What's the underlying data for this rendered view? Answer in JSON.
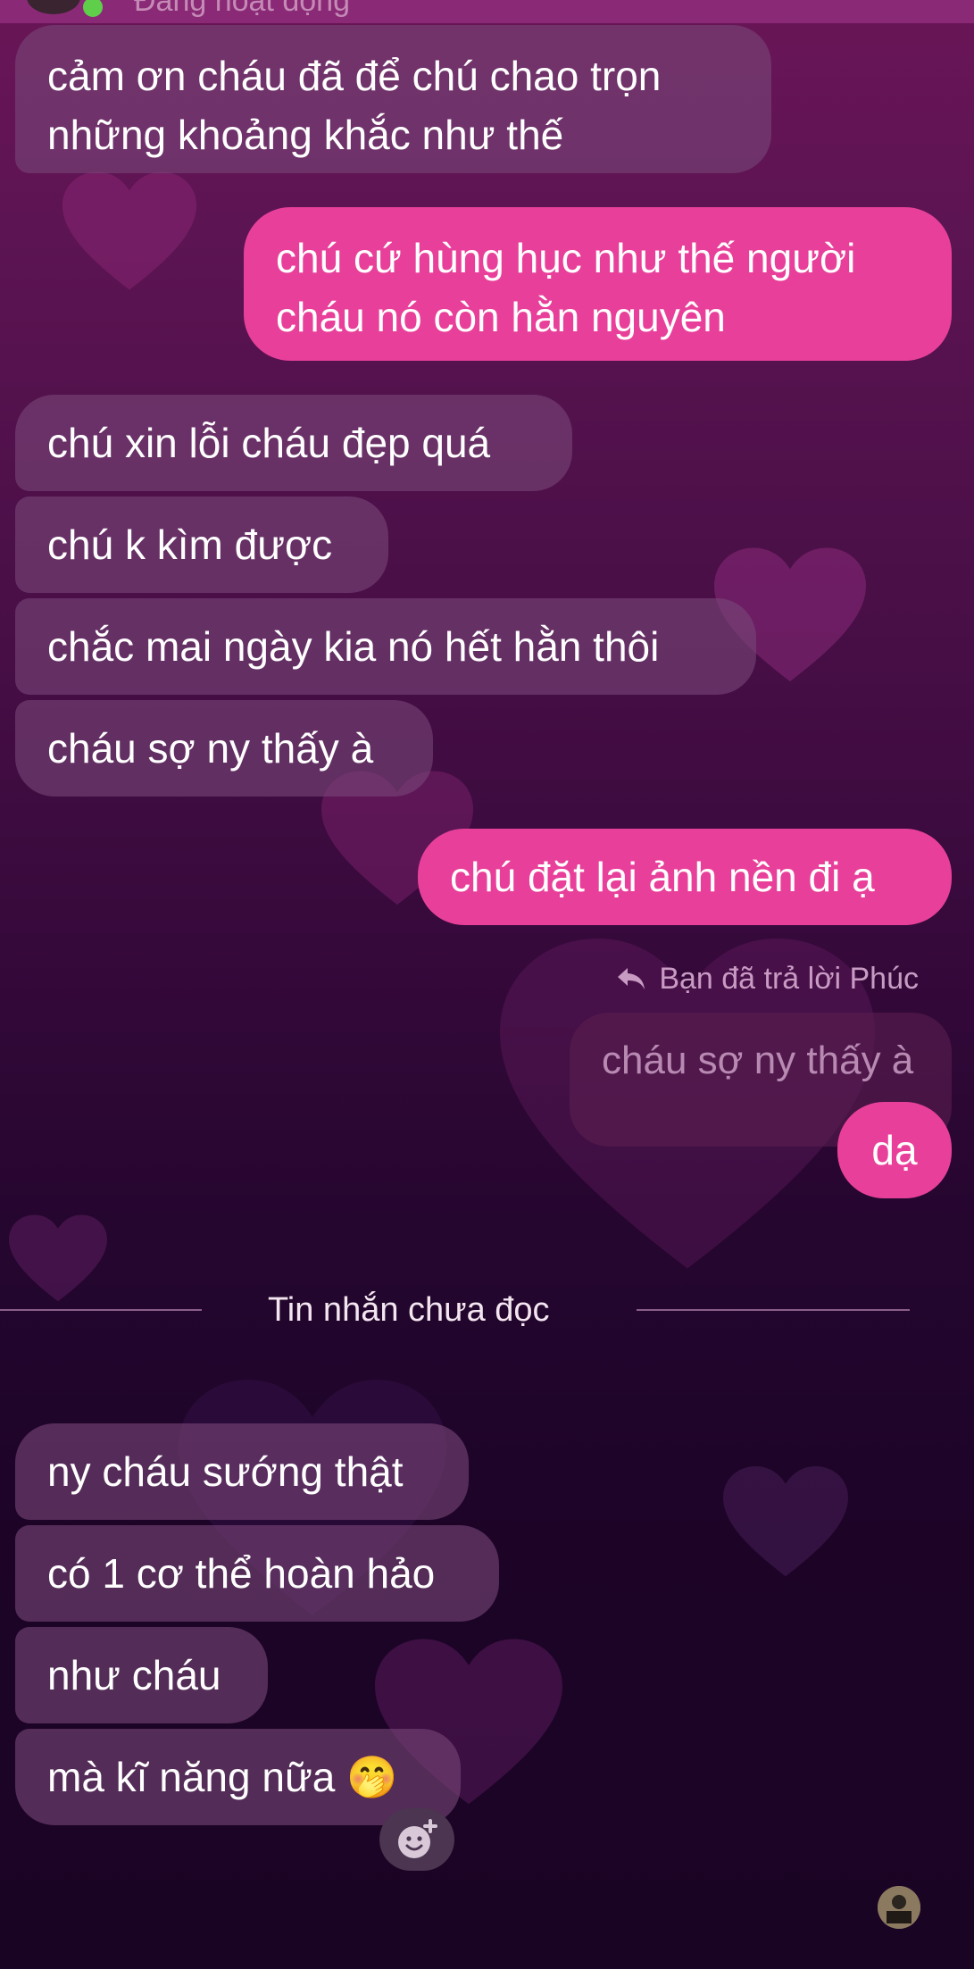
{
  "header": {
    "status_text": "Đang hoạt động"
  },
  "messages": [
    {
      "side": "in",
      "text_line1": "cảm ơn cháu đã để chú chao trọn",
      "text_line2": "những khoảng khắc như thế"
    },
    {
      "side": "out",
      "text_line1": "chú cứ hùng hục như thế người",
      "text_line2": "cháu nó còn hằn nguyên"
    },
    {
      "side": "in",
      "text": "chú xin lỗi cháu đẹp quá"
    },
    {
      "side": "in",
      "text": "chú k kìm được"
    },
    {
      "side": "in",
      "text": "chắc mai ngày kia nó hết hằn thôi"
    },
    {
      "side": "in",
      "text": "cháu sợ ny thấy à"
    },
    {
      "side": "out",
      "text": "chú đặt lại ảnh nền đi ạ"
    },
    {
      "side": "out",
      "text": "dạ"
    },
    {
      "side": "in",
      "text": "ny cháu sướng thật"
    },
    {
      "side": "in",
      "text": "có 1 cơ thể hoàn hảo"
    },
    {
      "side": "in",
      "text": "như cháu"
    },
    {
      "side": "in",
      "text": "mà kĩ năng nữa 🤭"
    }
  ],
  "reply": {
    "note": "Bạn đã trả lời Phúc",
    "quoted_text": "cháu sợ ny thấy à"
  },
  "divider": {
    "label": "Tin nhắn chưa đọc"
  },
  "colors": {
    "incoming_bubble": "#7a4678",
    "outgoing_bubble": "#e8409a",
    "online_dot": "#5fcf4b"
  },
  "icons": {
    "reply": "reply-arrow-icon",
    "react": "add-reaction-icon"
  }
}
